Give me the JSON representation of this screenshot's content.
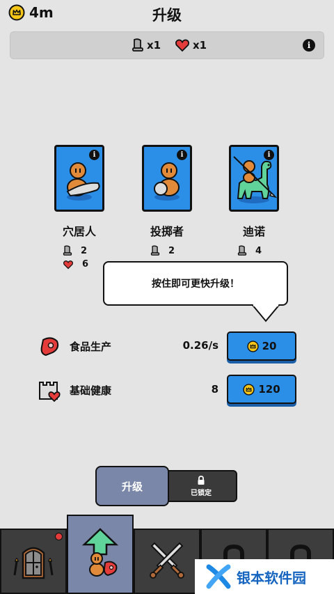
{
  "header": {
    "gold": "4m",
    "title": "升级"
  },
  "statbar": {
    "damage": "x1",
    "health": "x1",
    "info": "i"
  },
  "units": [
    {
      "name": "穴居人",
      "damage": "2",
      "health": "6",
      "info": "i"
    },
    {
      "name": "投掷者",
      "damage": "2",
      "health": "",
      "info": "i"
    },
    {
      "name": "迪诺",
      "damage": "4",
      "health": "",
      "info": "i"
    }
  ],
  "tooltip": {
    "text": "按住即可更快升级！"
  },
  "upgrades": [
    {
      "label": "食品生产",
      "value": "0.26/s",
      "cost": "20",
      "icon": "meat-icon"
    },
    {
      "label": "基础健康",
      "value": "8",
      "cost": "120",
      "icon": "castle-heart-icon"
    }
  ],
  "tabs": {
    "upgrade": "升级",
    "locked": "已锁定"
  },
  "watermark": {
    "text": "银本软件园"
  },
  "colors": {
    "card": "#2b8fe8",
    "active_tab": "#7a87a8",
    "nav_bg": "#3d3d3d",
    "notify": "#e43b3b"
  }
}
